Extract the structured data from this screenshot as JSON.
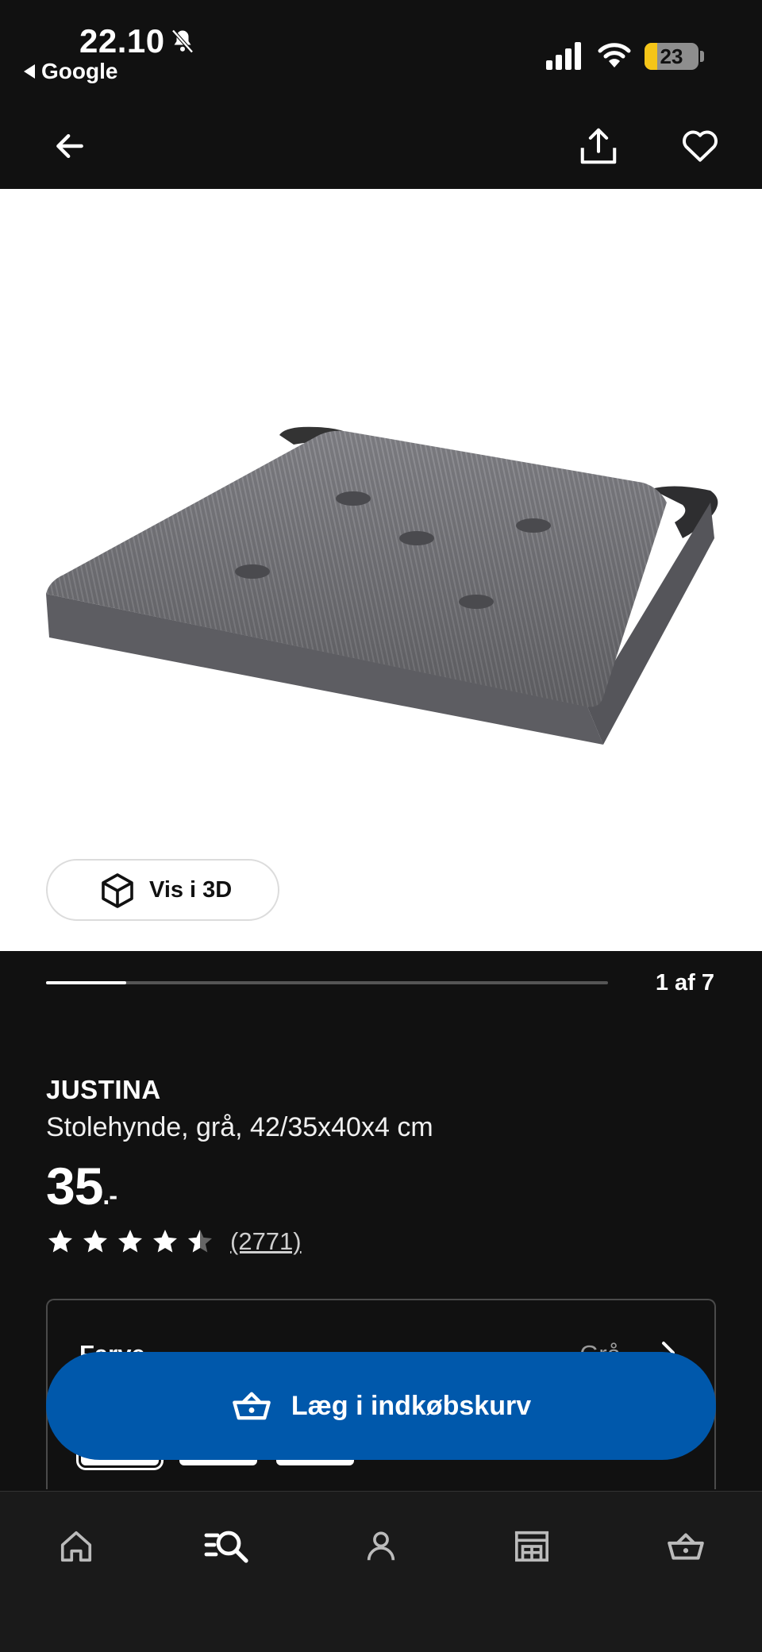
{
  "status_bar": {
    "time": "22.10",
    "back_app": "Google",
    "battery_percent": 23,
    "battery_label": "23",
    "icons": [
      "bell-muted-icon",
      "signal-icon",
      "wifi-icon",
      "battery-icon"
    ]
  },
  "toolbar": {
    "icons": [
      "back-arrow-icon",
      "share-icon",
      "heart-icon"
    ]
  },
  "hero": {
    "view_3d_label": "Vis i 3D",
    "icon": "cube-icon"
  },
  "carousel": {
    "current": 1,
    "total": 7,
    "counter_text": "1 af 7",
    "progress_fraction": 0.143
  },
  "product": {
    "name": "JUSTINA",
    "description": "Stolehynde, grå, 42/35x40x4 cm",
    "price": "35",
    "price_suffix": ".-",
    "rating": 4.5,
    "review_count": "(2771)"
  },
  "variant": {
    "label": "Farve",
    "value": "Grå",
    "swatch_count": 3
  },
  "cta": {
    "add_to_basket": "Læg i indkøbskurv",
    "icon": "basket-icon",
    "color": "#0058ab"
  },
  "bottom_nav": {
    "items": [
      "home-icon",
      "search-list-icon",
      "profile-icon",
      "store-icon",
      "basket-icon"
    ],
    "active": "search-list-icon"
  },
  "colors": {
    "background": "#111111",
    "primary": "#0058ab",
    "battery": "#f5c518"
  }
}
